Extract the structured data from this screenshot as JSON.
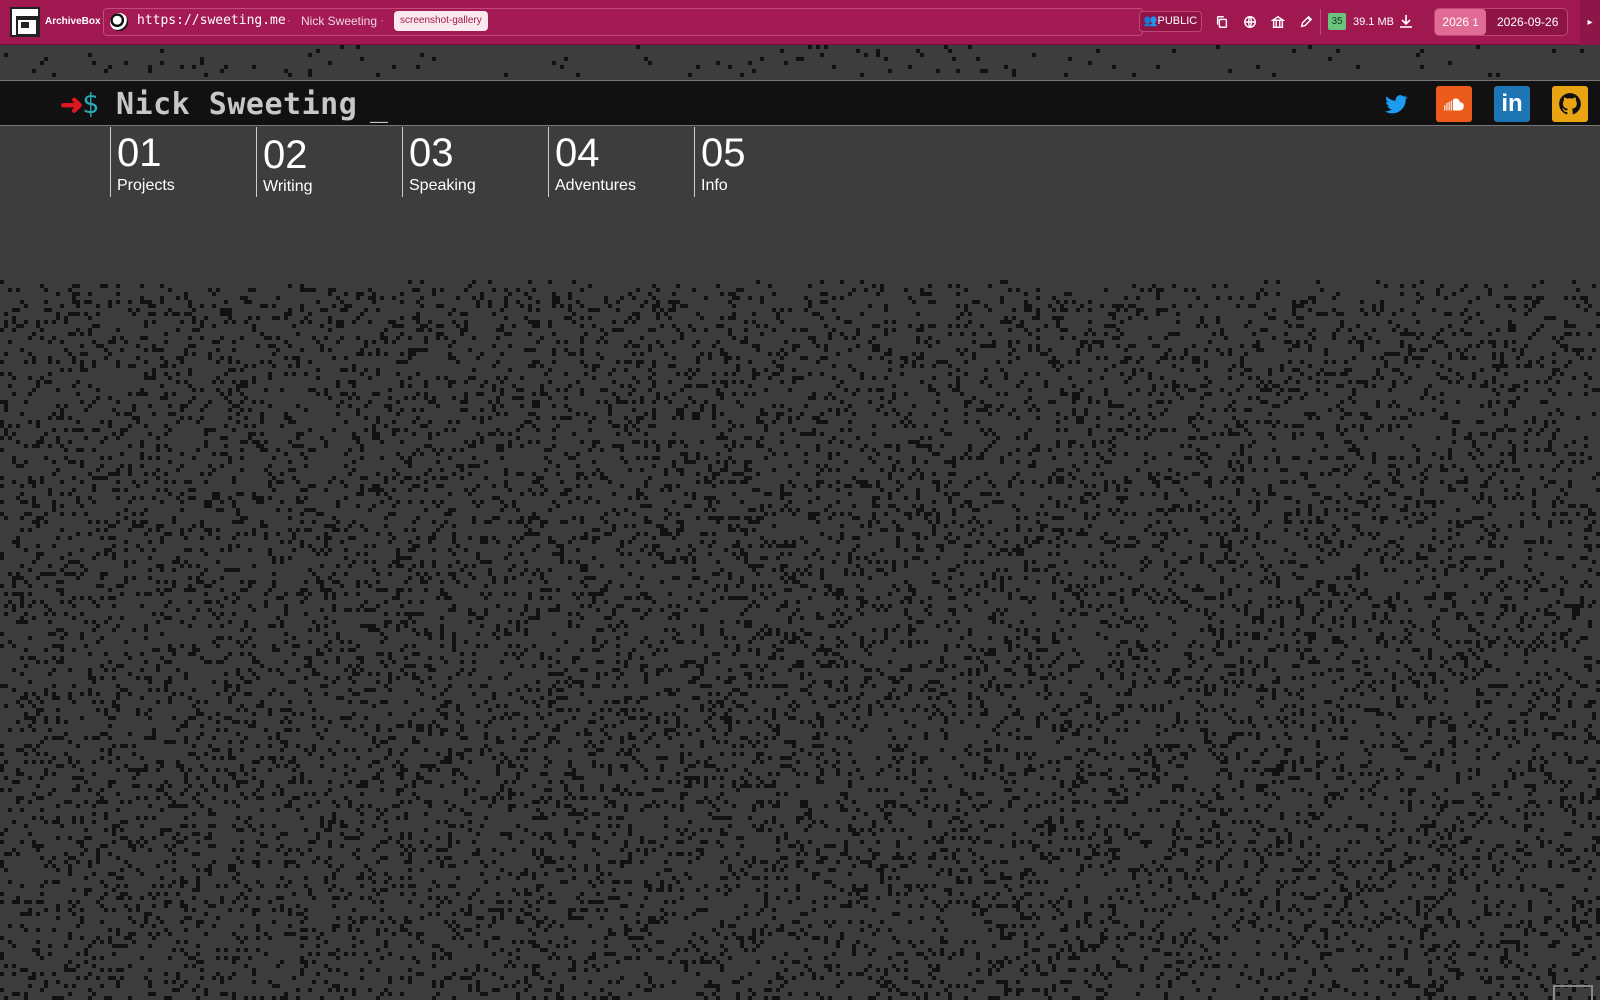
{
  "archivebox": {
    "name": "ArchiveBox",
    "url": "https://sweeting.me",
    "title": "Nick Sweeting",
    "tag": "screenshot-gallery",
    "visibility": "👥PUBLIC",
    "score": "35",
    "size": "39.1 MB",
    "year": "2026",
    "year_count": "1",
    "date": "2026-09-26",
    "collapse": "▸",
    "actions": [
      "copy-icon",
      "globe-icon",
      "archive-icon",
      "edit-icon"
    ]
  },
  "site": {
    "prompt_arrow": "➜",
    "prompt_dollar": "$",
    "title": "Nick Sweeting",
    "cursor": "_",
    "social": [
      "twitter-icon",
      "soundcloud-icon",
      "linkedin-icon",
      "github-icon"
    ],
    "linkedin_text": "in"
  },
  "nav": [
    {
      "num": "01",
      "label": "Projects"
    },
    {
      "num": "02",
      "label": "Writing"
    },
    {
      "num": "03",
      "label": "Speaking"
    },
    {
      "num": "04",
      "label": "Adventures"
    },
    {
      "num": "05",
      "label": "Info"
    }
  ],
  "colors": {
    "header": "#a01850",
    "background": "#3d3d3d",
    "cells": "#111111",
    "nav_bar": "#111111",
    "prompt_arrow": "#e0161e",
    "prompt_dollar": "#2aa8b8"
  }
}
